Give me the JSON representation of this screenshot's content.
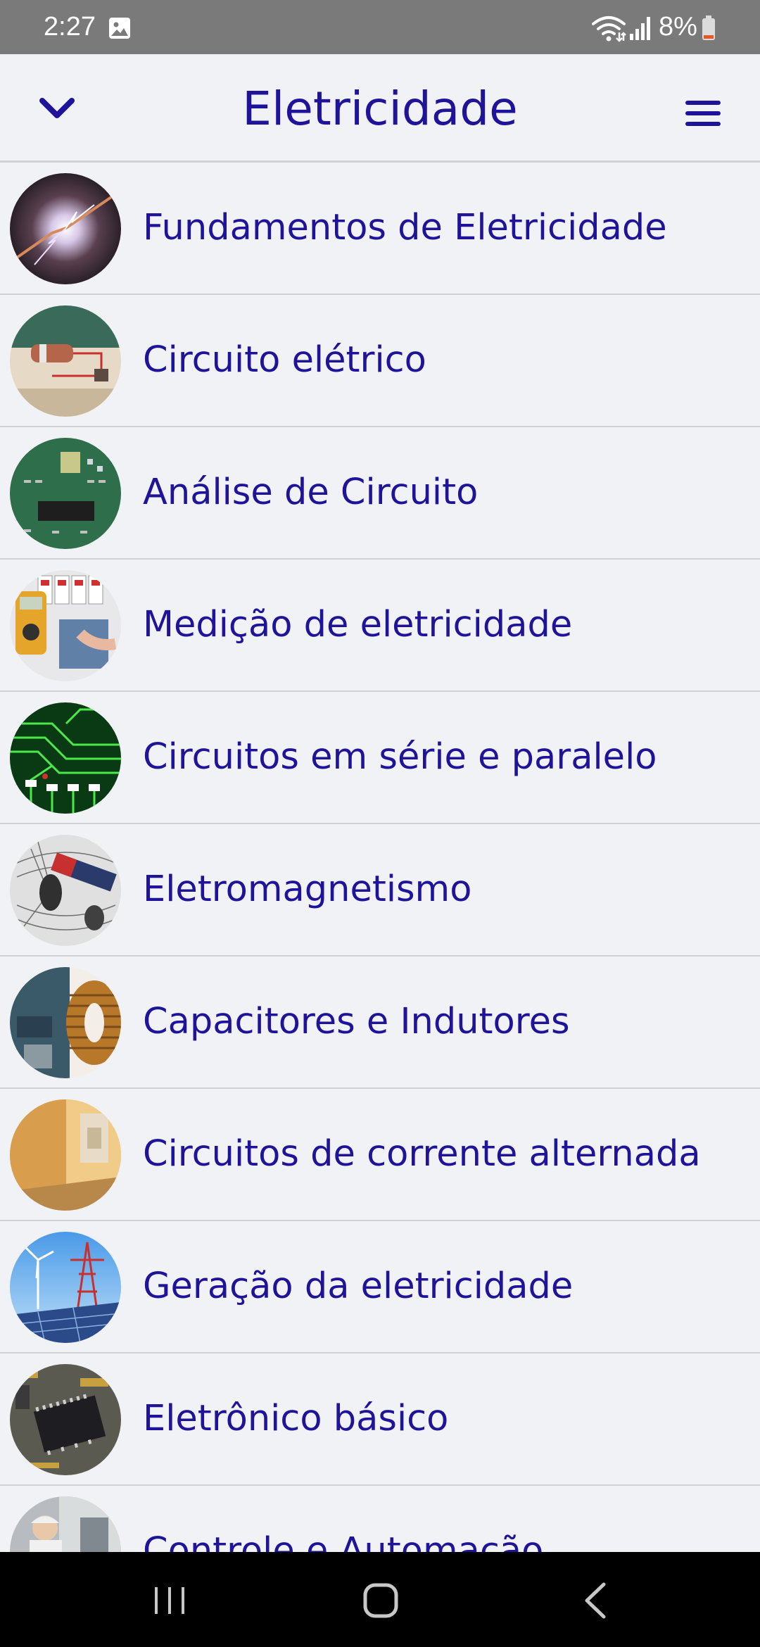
{
  "status_bar": {
    "time": "2:27",
    "battery_percent": "8%",
    "icons": [
      "gallery-icon",
      "wifi-icon",
      "signal-icon",
      "battery-low-icon"
    ],
    "battery_level": 0.08
  },
  "app_bar": {
    "title": "Eletricidade",
    "left_icon": "chevron-down-icon",
    "right_icon": "hamburger-menu-icon"
  },
  "topics": [
    {
      "label": "Fundamentos de Eletricidade",
      "thumb": "lightning-spark"
    },
    {
      "label": "Circuito elétrico",
      "thumb": "battery-circuit"
    },
    {
      "label": "Análise de Circuito",
      "thumb": "green-pcb"
    },
    {
      "label": "Medição de eletricidade",
      "thumb": "multimeter-panel"
    },
    {
      "label": "Circuitos em série e paralelo",
      "thumb": "pcb-traces"
    },
    {
      "label": "Eletromagnetismo",
      "thumb": "magnet-iron-filings"
    },
    {
      "label": "Capacitores e Indutores",
      "thumb": "inductor-coil"
    },
    {
      "label": "Circuitos de corrente alternada",
      "thumb": "wooden-socket"
    },
    {
      "label": "Geração da eletricidade",
      "thumb": "wind-solar-power"
    },
    {
      "label": "Eletrônico básico",
      "thumb": "microchip-board"
    },
    {
      "label": "Controle e Automação",
      "thumb": "worker-control"
    }
  ],
  "colors": {
    "accent": "#1f139a",
    "background": "#f1f2f6",
    "divider": "#cfd0d4",
    "status_bar": "#7a7a7a",
    "nav_bar": "#000000"
  },
  "nav_bar": {
    "icons": [
      "recents-icon",
      "home-icon",
      "back-icon"
    ]
  }
}
